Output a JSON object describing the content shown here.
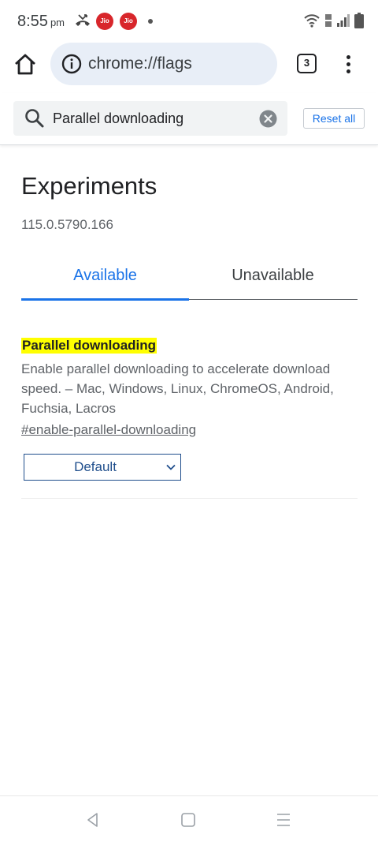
{
  "status_bar": {
    "time": "8:55",
    "ampm": "pm",
    "carrier_badges": [
      "Jio",
      "Jio"
    ],
    "icons": [
      "missed-call-icon",
      "wifi-icon",
      "volte-icon",
      "signal-icon",
      "battery-icon"
    ]
  },
  "toolbar": {
    "url": "chrome://flags",
    "tab_count": "3"
  },
  "search": {
    "query": "Parallel downloading",
    "reset_label": "Reset all"
  },
  "page": {
    "title": "Experiments",
    "version": "115.0.5790.166",
    "tabs": [
      {
        "label": "Available",
        "selected": true
      },
      {
        "label": "Unavailable",
        "selected": false
      }
    ]
  },
  "flag": {
    "name": "Parallel downloading",
    "description": "Enable parallel downloading to accelerate download speed. – Mac, Windows, Linux, ChromeOS, Android, Fuchsia, Lacros",
    "link": "#enable-parallel-downloading",
    "selected_option": "Default"
  },
  "colors": {
    "accent": "#1a73e8",
    "highlight": "#ffff00",
    "omnibox_bg": "#e8eef7"
  }
}
